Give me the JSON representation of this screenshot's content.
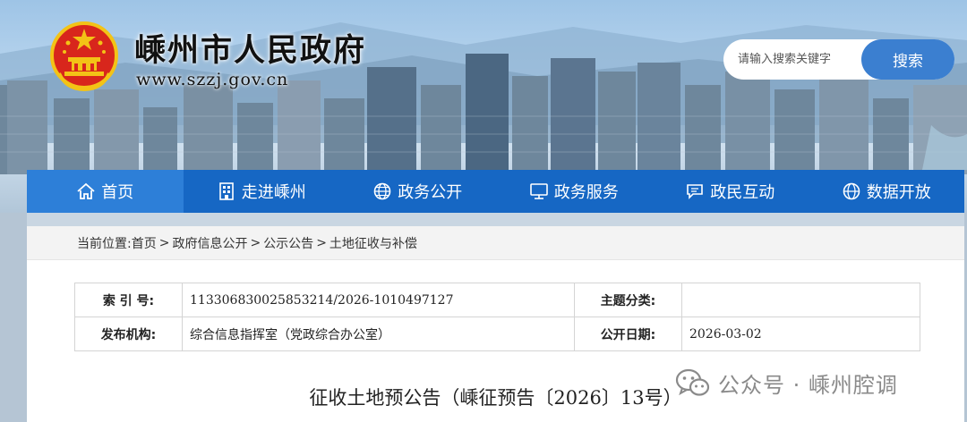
{
  "site": {
    "title": "嵊州市人民政府",
    "url": "www.szzj.gov.cn"
  },
  "search": {
    "placeholder": "请输入搜索关键字",
    "button_label": "搜索"
  },
  "nav": {
    "items": [
      {
        "label": "首页",
        "icon": "home-icon"
      },
      {
        "label": "走进嵊州",
        "icon": "building-icon"
      },
      {
        "label": "政务公开",
        "icon": "globe-icon"
      },
      {
        "label": "政务服务",
        "icon": "monitor-icon"
      },
      {
        "label": "政民互动",
        "icon": "chat-icon"
      },
      {
        "label": "数据开放",
        "icon": "globe-icon"
      }
    ]
  },
  "breadcrumb": {
    "prefix": "当前位置:",
    "items": [
      "首页",
      "政府信息公开",
      "公示公告",
      "土地征收与补偿"
    ],
    "separator": ">"
  },
  "meta": {
    "index_label": "索 引 号:",
    "index_value": "113306830025853214/2026-1010497127",
    "category_label": "主题分类:",
    "category_value": "",
    "publisher_label": "发布机构:",
    "publisher_value": "综合信息指挥室（党政综合办公室）",
    "date_label": "公开日期:",
    "date_value": "2026-03-02"
  },
  "document": {
    "title": "征收土地预公告（嵊征预告〔2026〕13号）"
  },
  "watermark": {
    "text": "公众号 · 嵊州腔调"
  },
  "colors": {
    "nav_blue": "#1667c4",
    "nav_active": "#2d7fd8",
    "search_button": "#3b7fd0",
    "emblem_red": "#d8261c",
    "emblem_gold": "#f3c316"
  }
}
